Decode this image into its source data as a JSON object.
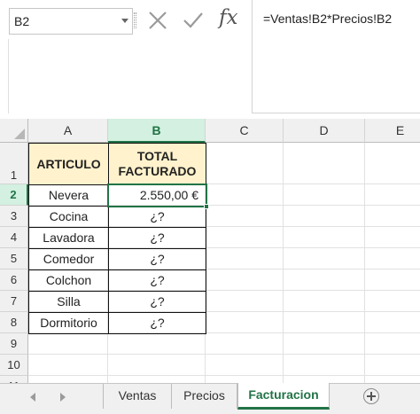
{
  "name_box": {
    "value": "B2"
  },
  "formula_bar": {
    "fx_label": "fx",
    "formula": "=Ventas!B2*Precios!B2"
  },
  "columns": [
    "A",
    "B",
    "C",
    "D",
    "E"
  ],
  "active_column": "B",
  "rows": [
    "1",
    "2",
    "3",
    "4",
    "5",
    "6",
    "7",
    "8",
    "9",
    "10",
    "11"
  ],
  "active_row": "2",
  "table": {
    "header": {
      "articulo": "ARTICULO",
      "total_line1": "TOTAL",
      "total_line2": "FACTURADO"
    },
    "items": [
      {
        "name": "Nevera",
        "total": "2.550,00 €"
      },
      {
        "name": "Cocina",
        "total": "¿?"
      },
      {
        "name": "Lavadora",
        "total": "¿?"
      },
      {
        "name": "Comedor",
        "total": "¿?"
      },
      {
        "name": "Colchon",
        "total": "¿?"
      },
      {
        "name": "Silla",
        "total": "¿?"
      },
      {
        "name": "Dormitorio",
        "total": "¿?"
      }
    ]
  },
  "sheet_tabs": [
    {
      "label": "Ventas",
      "active": false
    },
    {
      "label": "Precios",
      "active": false
    },
    {
      "label": "Facturacion",
      "active": true
    }
  ],
  "colors": {
    "accent": "#217346",
    "header_fill": "#fff2cc",
    "active_header_fill": "#d3f0e0"
  }
}
